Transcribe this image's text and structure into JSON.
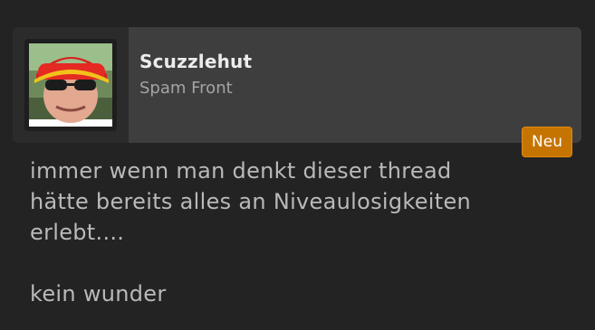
{
  "author": {
    "name": "Scuzzlehut",
    "title": "Spam Front",
    "avatar_icon": "user-avatar-photo"
  },
  "badge": {
    "label": "Neu",
    "color": "#c57400"
  },
  "message": {
    "line1": "immer wenn man denkt dieser thread",
    "line2": "hätte bereits alles an Niveaulosigkeiten",
    "line3": "erlebt....",
    "line4": "kein wunder"
  },
  "colors": {
    "background": "#232323",
    "header": "#3e3e3e",
    "text": "#b9b9b9"
  }
}
